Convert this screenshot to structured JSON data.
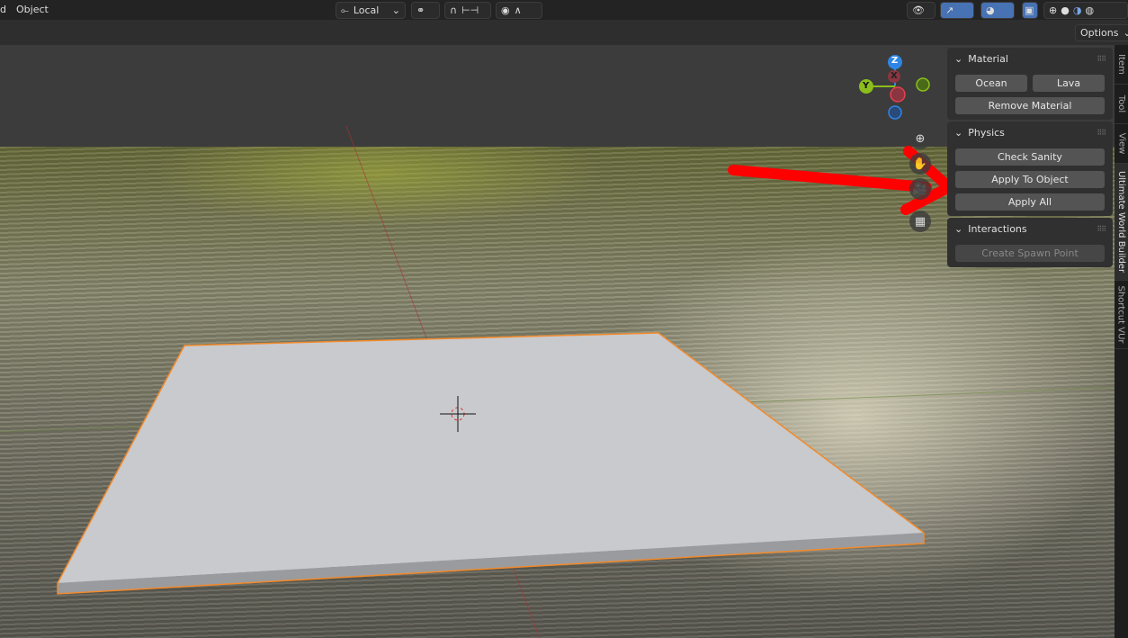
{
  "header": {
    "menu_partial": "d",
    "menu_object": "Object",
    "orientation": "Local",
    "options": "Options"
  },
  "icons": [
    "transform-orientation-icon",
    "pivot-icon",
    "snap-magnet-icon",
    "snap-increment-icon",
    "proportional-edit-icon",
    "falloff-curve-icon",
    "visibility-icon",
    "gizmo-icon",
    "overlay-icon",
    "xray-icon",
    "wireframe-shading-icon",
    "solid-shading-icon",
    "material-shading-icon",
    "rendered-shading-icon"
  ],
  "gizmo": {
    "x": "X",
    "y": "Y",
    "z": "Z",
    "x_color": "#e5414f",
    "y_color": "#8bbe1c",
    "z_color": "#2f85e3"
  },
  "panels": {
    "material": {
      "title": "Material",
      "ocean": "Ocean",
      "lava": "Lava",
      "remove": "Remove Material"
    },
    "physics": {
      "title": "Physics",
      "check": "Check Sanity",
      "apply_object": "Apply To Object",
      "apply_all": "Apply All"
    },
    "interactions": {
      "title": "Interactions",
      "spawn": "Create Spawn Point"
    }
  },
  "tabs": [
    "Item",
    "Tool",
    "View",
    "Ultimate World Builder",
    "Shortcut VUr"
  ],
  "selection_color": "#f28a2b",
  "annotation_arrow_color": "#ff0000"
}
